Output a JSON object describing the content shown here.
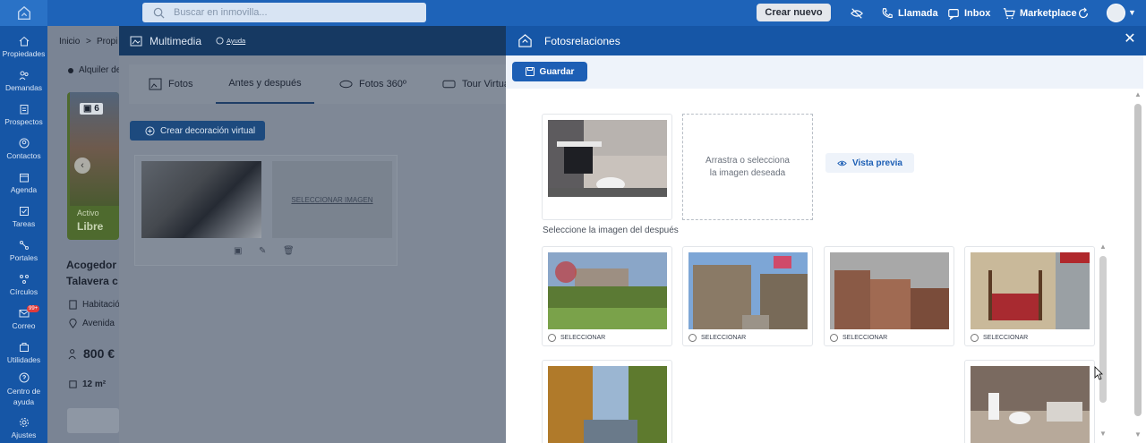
{
  "topbar": {
    "search_placeholder": "Buscar en inmovilla...",
    "crear_nuevo": "Crear nuevo",
    "llamada": "Llamada",
    "inbox": "Inbox",
    "marketplace": "Marketplace"
  },
  "sidebar": {
    "items": [
      {
        "label": "Propiedades",
        "icon": "home-icon"
      },
      {
        "label": "Demandas",
        "icon": "users-icon"
      },
      {
        "label": "Prospectos",
        "icon": "clipboard-icon"
      },
      {
        "label": "Contactos",
        "icon": "contact-icon"
      },
      {
        "label": "Agenda",
        "icon": "calendar-icon"
      },
      {
        "label": "Tareas",
        "icon": "tasks-icon"
      },
      {
        "label": "Portales",
        "icon": "portals-icon"
      },
      {
        "label": "Círculos",
        "icon": "circles-icon"
      },
      {
        "label": "Correo",
        "icon": "mail-icon",
        "badge": "99+"
      },
      {
        "label": "Utilidades",
        "icon": "toolbox-icon"
      },
      {
        "label": "Centro de",
        "label2": "ayuda",
        "icon": "help-icon"
      },
      {
        "label": "Ajustes",
        "icon": "gear-icon"
      }
    ]
  },
  "page": {
    "breadcrumb_home": "Inicio",
    "breadcrumb_sep": ">",
    "breadcrumb_next": "Propi",
    "listing_type": "Alquiler de",
    "photo_count": "6",
    "status_1": "Activo",
    "status_2": "Libre",
    "title_line1": "Acogedor",
    "title_line2": "Talavera c",
    "type": "Habitació",
    "address": "Avenida",
    "price": "800 €",
    "area": "12 m²"
  },
  "multimedia": {
    "title": "Multimedia",
    "help": "Ayuda",
    "tabs": [
      {
        "label": "Fotos"
      },
      {
        "label": "Antes y después"
      },
      {
        "label": "Fotos 360º"
      },
      {
        "label": "Tour Virtua"
      }
    ],
    "deco_button": "Crear decoración virtual",
    "select_image": "SELECCIONAR IMAGEN"
  },
  "fotosrelaciones": {
    "title": "Fotosrelaciones",
    "save": "Guardar",
    "dropzone_text": "Arrastra o selecciona la imagen deseada",
    "preview": "Vista previa",
    "select_after_title": "Seleccione la imagen del después",
    "select_label": "SELECCIONAR",
    "images": [
      {
        "name": "river-park-image",
        "selected": false
      },
      {
        "name": "stone-houses-image",
        "selected": false
      },
      {
        "name": "hanging-houses-image",
        "selected": false
      },
      {
        "name": "bedroom-image",
        "selected": false
      },
      {
        "name": "autumn-river-image",
        "selected": false
      },
      {
        "name": "bathroom-image",
        "selected": false
      }
    ]
  },
  "colors": {
    "primary": "#1656a6",
    "accent_button": "#1d5fb5",
    "overlay_header": "#163962"
  }
}
